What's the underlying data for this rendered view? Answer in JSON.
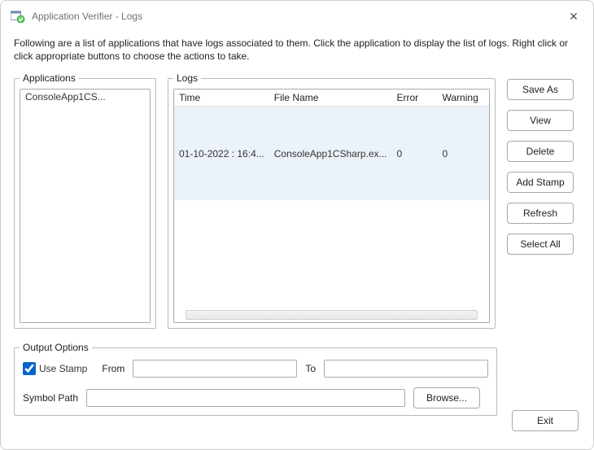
{
  "window": {
    "title": "Application Verifier - Logs",
    "close_glyph": "✕"
  },
  "instruction": "Following are a list of applications that have logs associated to them. Click the application to display the list of logs. Right click or click appropriate buttons to choose the actions to take.",
  "applications": {
    "legend": "Applications",
    "items": [
      "ConsoleApp1CS..."
    ]
  },
  "logs": {
    "legend": "Logs",
    "columns": [
      "Time",
      "File Name",
      "Error",
      "Warning"
    ],
    "rows": [
      {
        "time": "01-10-2022 : 16:4...",
        "file": "ConsoleApp1CSharp.ex...",
        "error": "0",
        "warning": "0"
      }
    ]
  },
  "buttons": {
    "save_as": "Save As",
    "view": "View",
    "delete": "Delete",
    "add_stamp": "Add Stamp",
    "refresh": "Refresh",
    "select_all": "Select All",
    "exit": "Exit"
  },
  "output": {
    "legend": "Output Options",
    "use_stamp_label": "Use Stamp",
    "use_stamp_checked": true,
    "from_label": "From",
    "from_value": "",
    "to_label": "To",
    "to_value": "",
    "symbol_label": "Symbol Path",
    "symbol_value": "",
    "browse_label": "Browse..."
  }
}
